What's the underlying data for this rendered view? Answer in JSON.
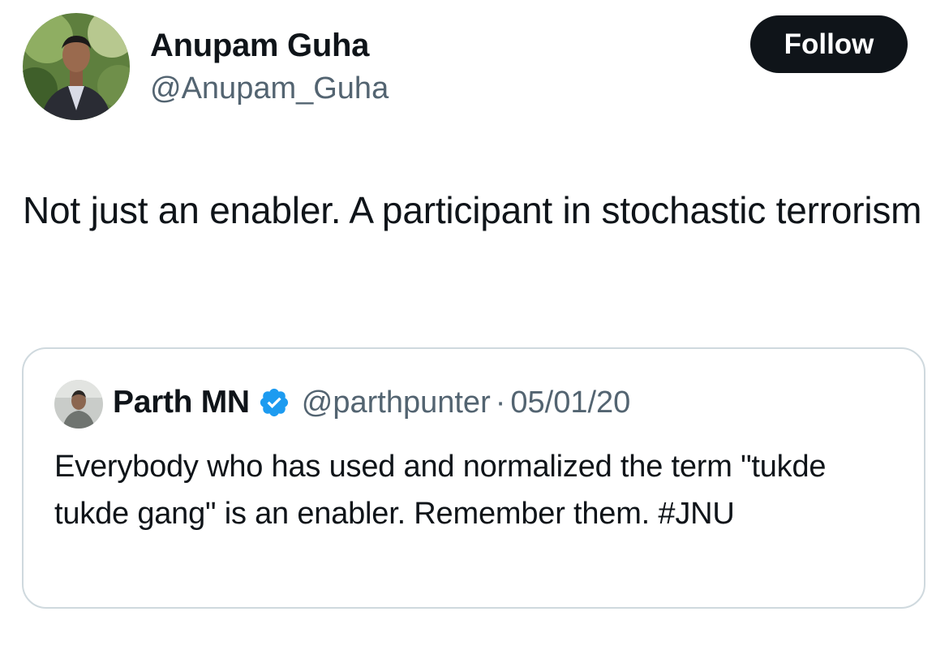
{
  "tweet": {
    "author": {
      "name": "Anupam Guha",
      "handle": "@Anupam_Guha"
    },
    "follow_label": "Follow",
    "text": "Not just an enabler. A participant in stochastic terrorism"
  },
  "quoted_tweet": {
    "author": {
      "name": "Parth MN",
      "handle": "@parthpunter",
      "verified": true
    },
    "separator": "·",
    "date": "05/01/20",
    "text": "Everybody who has used and normalized the term \"tukde tukde gang\" is an enabler. Remember them. #JNU"
  },
  "colors": {
    "text_primary": "#0f1419",
    "text_secondary": "#536471",
    "follow_bg": "#0f1419",
    "border": "#cfd9de",
    "verified_blue": "#1d9bf0"
  }
}
